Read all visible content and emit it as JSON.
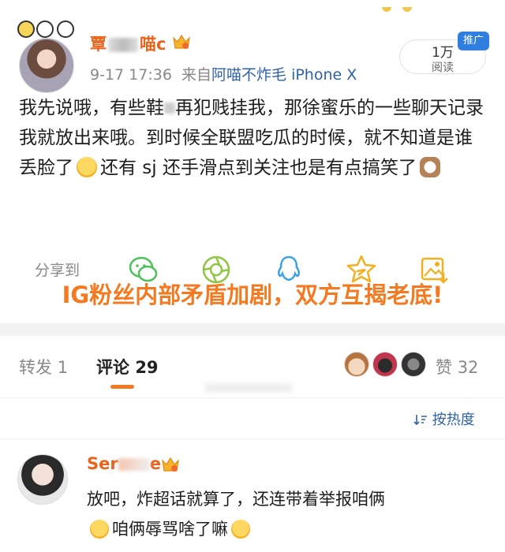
{
  "post": {
    "username_prefix": "覃",
    "username_suffix": "喵c",
    "time": "9-17 17:36",
    "source_prefix": "来自",
    "source": "阿喵不炸毛 iPhone X",
    "read_count": "1万",
    "read_label": "阅读",
    "promo_label": "推广",
    "content_1": "我先说哦，有些鞋",
    "content_2": "再犯贱挂我，那徐蜜乐的一些聊天记录我就放出来哦。到时候全联盟吃瓜的时候，就不知道是谁丢脸了",
    "content_3": "还有 sj 还手滑点到关注也是有点搞笑了"
  },
  "share": {
    "label": "分享到",
    "icons": [
      "wechat-icon",
      "moments-icon",
      "qq-icon",
      "qzone-icon",
      "save-image-icon"
    ]
  },
  "overlay_caption": "IG粉丝内部矛盾加剧，双方互揭老底!",
  "tabs": {
    "repost_label": "转发",
    "repost_count": "1",
    "comment_label": "评论",
    "comment_count": "29",
    "like_label": "赞",
    "like_count": "32"
  },
  "sort_label": "按热度",
  "comment": {
    "name_prefix": "Ser",
    "name_suffix": "e",
    "text_1": "放吧，炸超话就算了，还连带着举报咱俩",
    "text_2": "咱俩辱骂啥了嘛"
  },
  "colors": {
    "accent": "#f37a21",
    "username": "#e8631c",
    "link": "#2e62a8",
    "promo": "#2f7ee0"
  }
}
